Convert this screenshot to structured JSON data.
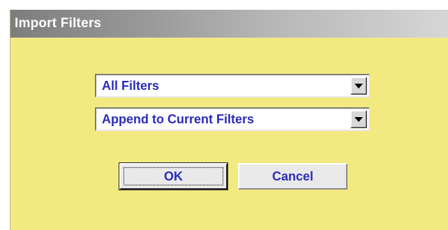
{
  "dialog": {
    "title": "Import Filters",
    "filter_select": {
      "value": "All Filters"
    },
    "mode_select": {
      "value": "Append to Current Filters"
    },
    "ok_label": "OK",
    "cancel_label": "Cancel"
  },
  "colors": {
    "dialog_background": "#f2ea80",
    "label_text": "#2b2bbd",
    "button_face": "#e9e9e9",
    "title_text": "#ffffff"
  }
}
